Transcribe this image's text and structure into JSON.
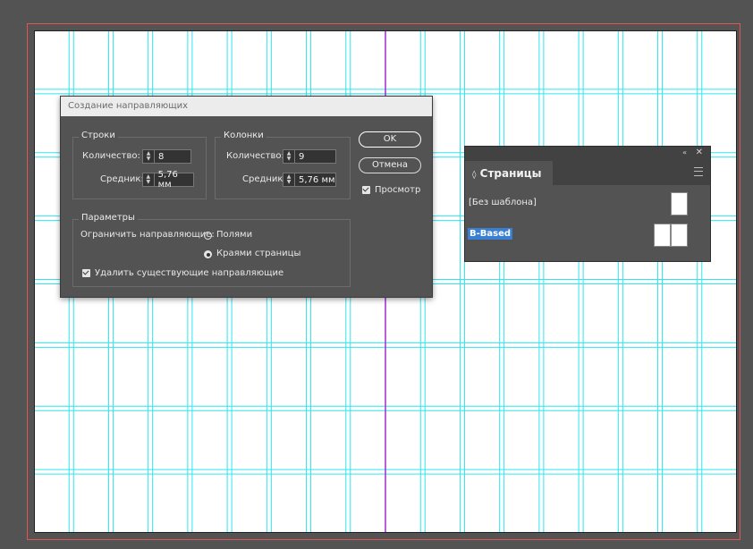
{
  "dialog": {
    "title": "Создание направляющих",
    "rows": {
      "title": "Строки",
      "count_label": "Количество:",
      "count_value": "8",
      "gutter_label": "Средник:",
      "gutter_value": "5,76 мм"
    },
    "columns": {
      "title": "Колонки",
      "count_label": "Количество:",
      "count_value": "9",
      "gutter_label": "Средник:",
      "gutter_value": "5,76 мм"
    },
    "ok_label": "OK",
    "cancel_label": "Отмена",
    "preview_label": "Просмотр",
    "preview_checked": true,
    "options": {
      "title": "Параметры",
      "fit_label": "Ограничить направляющие:",
      "fit_margins_label": "Полями",
      "fit_page_label": "Краями страницы",
      "fit_selected": "page",
      "remove_existing_label": "Удалить существующие направляющие",
      "remove_existing_checked": true
    }
  },
  "pages_panel": {
    "tab_label": "Страницы",
    "collapse_icon": "«",
    "close_icon": "✕",
    "masters": [
      {
        "label": "[Без шаблона]",
        "pages": 1
      },
      {
        "label": "B-Based",
        "pages": 2,
        "selected": true
      }
    ]
  },
  "colors": {
    "workspace": "#535353",
    "guide": "#2ce6f0",
    "spine": "#a02cd0",
    "bleed": "#e0554f",
    "selection": "#3a80d2"
  }
}
